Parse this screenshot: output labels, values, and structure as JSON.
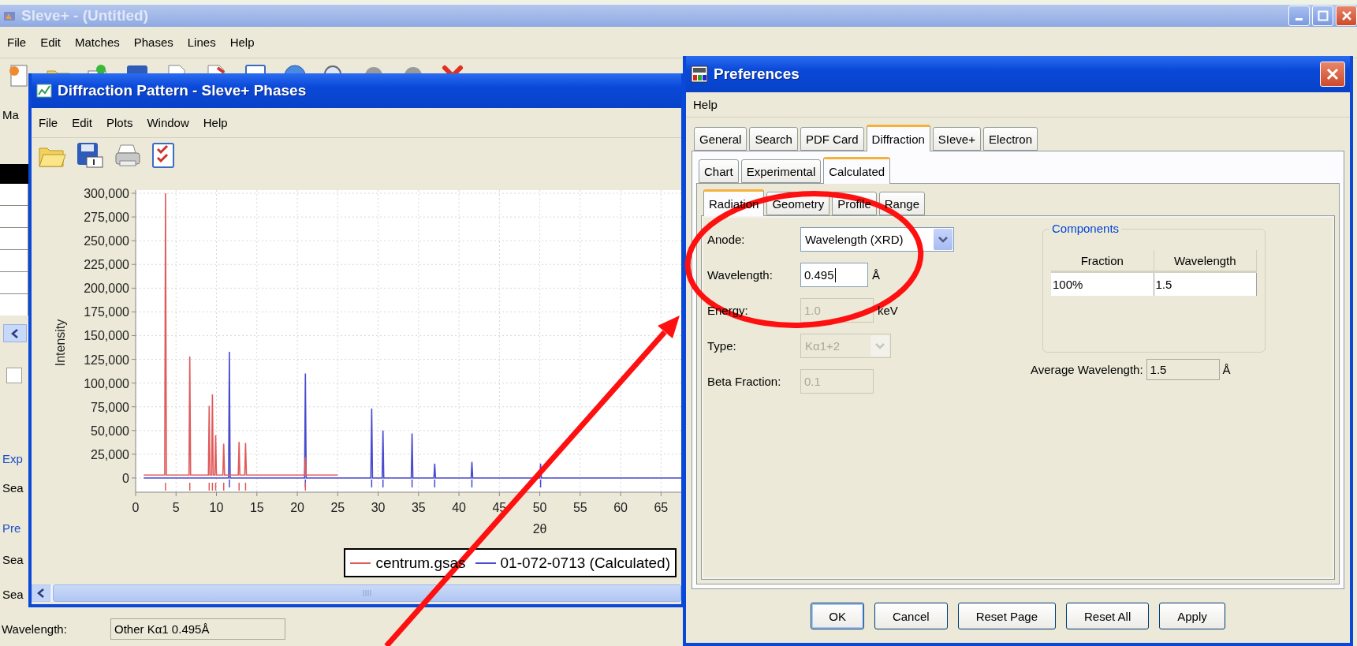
{
  "main_window": {
    "title": "Sleve+ - (Untitled)",
    "menu": [
      "File",
      "Edit",
      "Matches",
      "Phases",
      "Lines",
      "Help"
    ],
    "side_panel": [
      {
        "kind": "text",
        "label": "Ma"
      },
      {
        "kind": "table"
      },
      {
        "kind": "scroll"
      },
      {
        "kind": "checkbox",
        "checked": false
      },
      {
        "kind": "link",
        "label": "Exp"
      },
      {
        "kind": "text",
        "label": "Sea"
      },
      {
        "kind": "link",
        "label": "Pre"
      },
      {
        "kind": "text",
        "label": "Sea"
      },
      {
        "kind": "text",
        "label": "Sea"
      }
    ],
    "wavelength": {
      "label": "Wavelength:",
      "value": "Other Kα1 0.495Å"
    }
  },
  "diffraction_window": {
    "title": "Diffraction Pattern - Sleve+ Phases",
    "menu": [
      "File",
      "Edit",
      "Plots",
      "Window",
      "Help"
    ],
    "chart_data": {
      "type": "line",
      "grid": true,
      "xlabel": "2θ",
      "ylabel": "Intensity",
      "xlim": [
        0,
        67.5
      ],
      "ylim": [
        -15000,
        300000
      ],
      "x": [
        1,
        3.6,
        3.7,
        3.8,
        6.6,
        6.7,
        6.8,
        9.0,
        9.1,
        9.2,
        9.4,
        9.5,
        9.6,
        9.8,
        9.9,
        10.0,
        10.8,
        10.9,
        11.0,
        11.5,
        11.6,
        11.7,
        12.7,
        12.8,
        12.9,
        13.5,
        13.6,
        13.7,
        20.9,
        21.0,
        21.1,
        25,
        29.1,
        29.2,
        29.3,
        30.5,
        30.6,
        30.7,
        34.1,
        34.2,
        34.3,
        36.9,
        37.0,
        37.1,
        41.5,
        41.6,
        41.7,
        50.0,
        50.1,
        50.2,
        67.5
      ],
      "series": [
        {
          "name": "centrum.gsas",
          "color": "#e05a5a",
          "values": [
            3000,
            3000,
            300000,
            3000,
            3000,
            128000,
            3000,
            3000,
            76000,
            3000,
            3000,
            88000,
            3000,
            3000,
            45000,
            3000,
            3000,
            36000,
            3000,
            3000,
            3000,
            3000,
            3000,
            38000,
            3000,
            3000,
            37000,
            3000,
            3000,
            22000,
            3000,
            3000,
            null,
            null,
            null,
            null,
            null,
            null,
            null,
            null,
            null,
            null,
            null,
            null,
            null,
            null,
            null,
            null,
            null,
            null,
            null
          ]
        },
        {
          "name": "01-072-0713 (Calculated)",
          "color": "#4a4ad0",
          "values": [
            0,
            0,
            0,
            0,
            0,
            0,
            0,
            0,
            0,
            0,
            0,
            0,
            0,
            0,
            0,
            0,
            0,
            0,
            0,
            0,
            133000,
            0,
            0,
            0,
            0,
            0,
            0,
            0,
            0,
            110000,
            0,
            0,
            0,
            73000,
            0,
            0,
            50000,
            0,
            0,
            47000,
            0,
            0,
            15000,
            0,
            0,
            17000,
            0,
            0,
            15000,
            0,
            0
          ]
        }
      ],
      "xticks": [
        0,
        5,
        10,
        15,
        20,
        25,
        30,
        35,
        40,
        45,
        50,
        55,
        60,
        65
      ],
      "yticks": [
        {
          "value": 0,
          "label": "0"
        },
        {
          "value": 25000,
          "label": "25,000"
        },
        {
          "value": 50000,
          "label": "50,000"
        },
        {
          "value": 75000,
          "label": "75,000"
        },
        {
          "value": 100000,
          "label": "100,000"
        },
        {
          "value": 125000,
          "label": "125,000"
        },
        {
          "value": 150000,
          "label": "150,000"
        },
        {
          "value": 175000,
          "label": "175,000"
        },
        {
          "value": 200000,
          "label": "200,000"
        },
        {
          "value": 225000,
          "label": "225,000"
        },
        {
          "value": 250000,
          "label": "250,000"
        },
        {
          "value": 275000,
          "label": "275,000"
        },
        {
          "value": 300000,
          "label": "300,000"
        }
      ]
    }
  },
  "preferences": {
    "title": "Preferences",
    "menu": [
      "Help"
    ],
    "tabs": [
      {
        "label": "General",
        "selected": false
      },
      {
        "label": "Search",
        "selected": false
      },
      {
        "label": "PDF Card",
        "selected": false
      },
      {
        "label": "Diffraction",
        "selected": true
      },
      {
        "label": "SIeve+",
        "selected": false
      },
      {
        "label": "Electron",
        "selected": false
      }
    ],
    "subtabs": [
      {
        "label": "Chart",
        "selected": false
      },
      {
        "label": "Experimental",
        "selected": false
      },
      {
        "label": "Calculated",
        "selected": true
      }
    ],
    "radiation_tabs": [
      {
        "label": "Radiation",
        "selected": true
      },
      {
        "label": "Geometry",
        "selected": false
      },
      {
        "label": "Profile",
        "selected": false
      },
      {
        "label": "Range",
        "selected": false
      }
    ],
    "fields": [
      {
        "kind": "dropdown",
        "label": "Anode:",
        "value": "Wavelength (XRD)",
        "disabled": false
      },
      {
        "kind": "text",
        "label": "Wavelength:",
        "value": "0.495",
        "unit": "Å",
        "disabled": false
      },
      {
        "kind": "text",
        "label": "Energy:",
        "value": "1.0",
        "unit": "keV",
        "disabled": true
      },
      {
        "kind": "dropdown",
        "label": "Type:",
        "value": "Kα1+2",
        "disabled": true
      },
      {
        "kind": "text",
        "label": "Beta Fraction:",
        "value": "0.1",
        "disabled": true
      }
    ],
    "components": {
      "title": "Components",
      "columns": [
        "Fraction",
        "Wavelength"
      ],
      "rows": [
        [
          "100%",
          "1.5"
        ]
      ]
    },
    "average_wavelength": {
      "label": "Average Wavelength:",
      "value": "1.5",
      "unit": "Å"
    },
    "buttons": [
      {
        "label": "OK",
        "default": true
      },
      {
        "label": "Cancel",
        "default": false
      },
      {
        "label": "Reset Page",
        "default": false
      },
      {
        "label": "Reset All",
        "default": false
      },
      {
        "label": "Apply",
        "default": false
      }
    ]
  }
}
